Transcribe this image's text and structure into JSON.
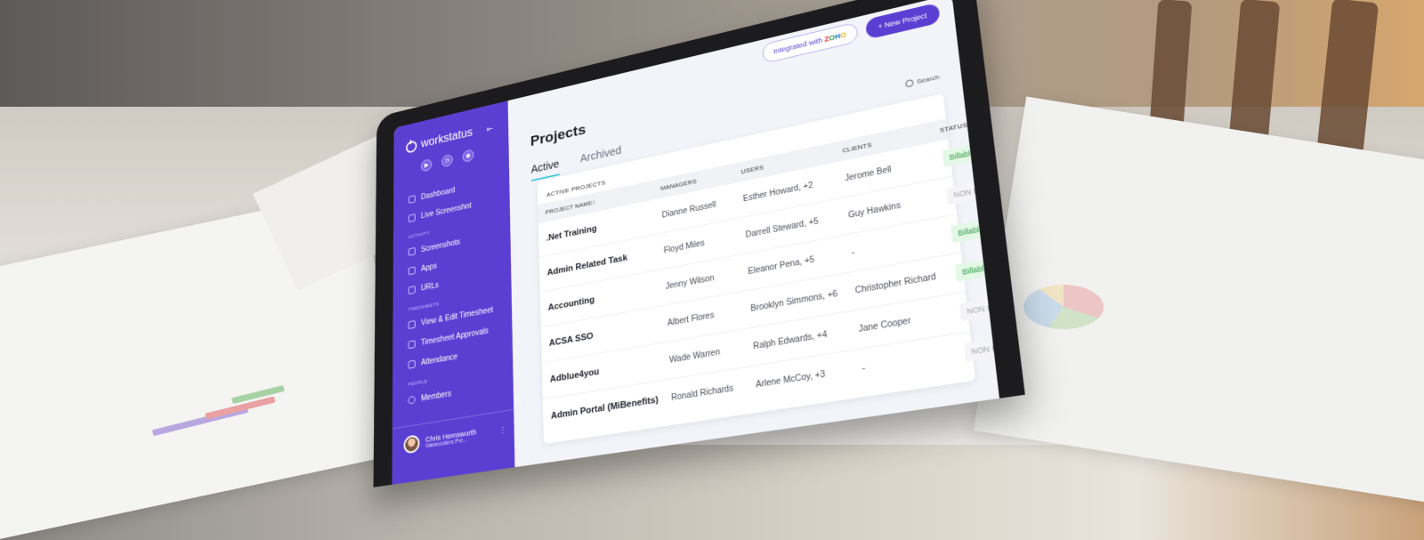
{
  "sidebar": {
    "brand": "workstatus",
    "collapse_icon": "collapse-left-icon",
    "top_icons": [
      "play-icon",
      "clock-icon",
      "bell-icon"
    ],
    "items_top": [
      {
        "label": "Dashboard",
        "icon": "dashboard-icon"
      },
      {
        "label": "Live Screenshot",
        "icon": "live-screenshot-icon"
      }
    ],
    "sections": [
      {
        "title": "ACTIVITY",
        "items": [
          {
            "label": "Screenshots",
            "icon": "screenshot-icon"
          },
          {
            "label": "Apps",
            "icon": "apps-icon"
          },
          {
            "label": "URLs",
            "icon": "url-icon"
          }
        ]
      },
      {
        "title": "TIMESHEETS",
        "items": [
          {
            "label": "View & Edit Timesheet",
            "icon": "timesheet-icon"
          },
          {
            "label": "Timesheet Approvals",
            "icon": "approval-icon"
          },
          {
            "label": "Attendance",
            "icon": "attendance-icon"
          }
        ]
      },
      {
        "title": "PEOPLE",
        "items": [
          {
            "label": "Members",
            "icon": "members-icon"
          }
        ]
      }
    ],
    "user": {
      "name": "Chris Hemsworth",
      "company": "Valuecoders Pvt..."
    }
  },
  "header": {
    "integrated_label": "Integrated with",
    "zoho_letters": [
      "Z",
      "O",
      "H",
      "O"
    ],
    "new_project_label": "+ New Project",
    "page_title": "Projects",
    "tabs": [
      {
        "label": "Active",
        "active": true
      },
      {
        "label": "Archived",
        "active": false
      }
    ],
    "search_placeholder": "Search"
  },
  "table": {
    "title": "ACTIVE PROJECTS",
    "columns": [
      "PROJECT NAME↑",
      "MANAGERS",
      "USERS",
      "CLIENTS",
      "STATUS"
    ],
    "rows": [
      {
        "project": ".Net Training",
        "manager": "Dianne Russell",
        "users": "Esther Howard, +2",
        "client": "Jerome Bell",
        "status": "Billable",
        "billable": true
      },
      {
        "project": "Admin Related Task",
        "manager": "Floyd Miles",
        "users": "Darrell Steward, +5",
        "client": "Guy Hawkins",
        "status": "NON Billable",
        "billable": false
      },
      {
        "project": "Accounting",
        "manager": "Jenny Wilson",
        "users": "Eleanor Pena, +5",
        "client": "-",
        "status": "Billable",
        "billable": true
      },
      {
        "project": "ACSA SSO",
        "manager": "Albert Flores",
        "users": "Brooklyn Simmons, +6",
        "client": "Christopher Richard",
        "status": "Billable",
        "billable": true
      },
      {
        "project": "Adblue4you",
        "manager": "Wade Warren",
        "users": "Ralph Edwards, +4",
        "client": "Jane Cooper",
        "status": "NON Billable",
        "billable": false
      },
      {
        "project": "Admin Portal (MiBenefits)",
        "manager": "Ronald Richards",
        "users": "Arlene McCoy, +3",
        "client": "-",
        "status": "NON Billable",
        "billable": false
      }
    ]
  },
  "colors": {
    "sidebar": "#5b3fd3",
    "accent_tab": "#38c6d9",
    "billable": "#2f9a44"
  }
}
